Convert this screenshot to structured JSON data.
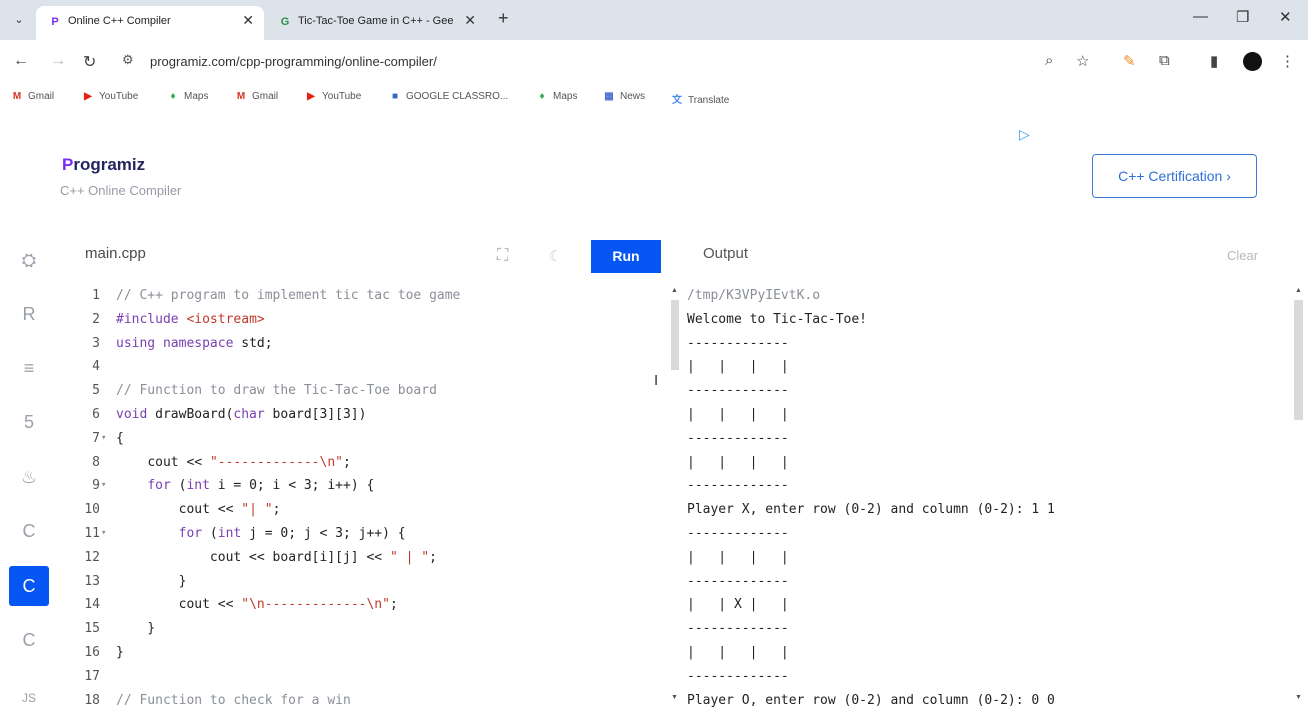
{
  "browser": {
    "tabs": [
      {
        "title": "Online C++ Compiler",
        "favicon": "programiz-p-icon",
        "active": true
      },
      {
        "title": "Tic-Tac-Toe Game in C++ - Gee",
        "favicon": "gfg-icon",
        "active": false
      }
    ],
    "new_tab": "+",
    "url": "programiz.com/cpp-programming/online-compiler/",
    "bookmarks": [
      {
        "label": "Gmail",
        "icon": "gmail-icon",
        "glyph": "M",
        "color": "#d93025"
      },
      {
        "label": "YouTube",
        "icon": "youtube-icon",
        "glyph": "▶",
        "color": "#e62117"
      },
      {
        "label": "Maps",
        "icon": "maps-icon",
        "glyph": "♦",
        "color": "#34a853"
      },
      {
        "label": "Gmail",
        "icon": "gmail-icon",
        "glyph": "M",
        "color": "#d93025"
      },
      {
        "label": "YouTube",
        "icon": "youtube-icon",
        "glyph": "▶",
        "color": "#e62117"
      },
      {
        "label": "GOOGLE CLASSRO...",
        "icon": "classroom-icon",
        "glyph": "■",
        "color": "#3a66c4"
      },
      {
        "label": "Maps",
        "icon": "maps-icon",
        "glyph": "♦",
        "color": "#34a853"
      },
      {
        "label": "News",
        "icon": "news-icon",
        "glyph": "▦",
        "color": "#4a6fd0"
      },
      {
        "label": "Translate",
        "icon": "translate-icon",
        "glyph": "文",
        "color": "#4a8af4"
      }
    ]
  },
  "page": {
    "logo_text": "rogramiz",
    "logo_initial": "P",
    "subtitle": "C++ Online Compiler",
    "cert_button": "C++ Certification ›",
    "file_name": "main.cpp",
    "run_button": "Run",
    "output_label": "Output",
    "clear_button": "Clear",
    "accent_color": "#0556f3"
  },
  "sidebar": {
    "items": [
      {
        "name": "python",
        "glyph": "⛭",
        "active": false
      },
      {
        "name": "r",
        "glyph": "R",
        "active": false
      },
      {
        "name": "sql",
        "glyph": "≡",
        "active": false
      },
      {
        "name": "html",
        "glyph": "5",
        "active": false
      },
      {
        "name": "java",
        "glyph": "♨",
        "active": false
      },
      {
        "name": "c",
        "glyph": "C",
        "active": false
      },
      {
        "name": "cpp",
        "glyph": "C",
        "active": true
      },
      {
        "name": "csharp",
        "glyph": "C",
        "active": false
      },
      {
        "name": "js",
        "glyph": "JS",
        "active": false
      }
    ]
  },
  "editor": {
    "lines": [
      {
        "n": "1",
        "fold": "",
        "code": "// C++ program to implement tic tac toe game"
      },
      {
        "n": "2",
        "fold": "",
        "code": "#include <iostream>"
      },
      {
        "n": "3",
        "fold": "",
        "code": "using namespace std;"
      },
      {
        "n": "4",
        "fold": "",
        "code": ""
      },
      {
        "n": "5",
        "fold": "",
        "code": "// Function to draw the Tic-Tac-Toe board"
      },
      {
        "n": "6",
        "fold": "",
        "code": "void drawBoard(char board[3][3])"
      },
      {
        "n": "7",
        "fold": "▾",
        "code": "{"
      },
      {
        "n": "8",
        "fold": "",
        "code": "    cout << \"-------------\\n\";"
      },
      {
        "n": "9",
        "fold": "▾",
        "code": "    for (int i = 0; i < 3; i++) {"
      },
      {
        "n": "10",
        "fold": "",
        "code": "        cout << \"| \";"
      },
      {
        "n": "11",
        "fold": "▾",
        "code": "        for (int j = 0; j < 3; j++) {"
      },
      {
        "n": "12",
        "fold": "",
        "code": "            cout << board[i][j] << \" | \";"
      },
      {
        "n": "13",
        "fold": "",
        "code": "        }"
      },
      {
        "n": "14",
        "fold": "",
        "code": "        cout << \"\\n-------------\\n\";"
      },
      {
        "n": "15",
        "fold": "",
        "code": "    }"
      },
      {
        "n": "16",
        "fold": "",
        "code": "}"
      },
      {
        "n": "17",
        "fold": "",
        "code": ""
      },
      {
        "n": "18",
        "fold": "",
        "code": "// Function to check for a win"
      }
    ]
  },
  "output": {
    "lines": [
      "/tmp/K3VPyIEvtK.o",
      "Welcome to Tic-Tac-Toe!",
      "-------------",
      "|   |   |   |",
      "-------------",
      "|   |   |   |",
      "-------------",
      "|   |   |   |",
      "-------------",
      "Player X, enter row (0-2) and column (0-2): 1 1",
      "-------------",
      "|   |   |   |",
      "-------------",
      "|   | X |   |",
      "-------------",
      "|   |   |   |",
      "-------------",
      "Player O, enter row (0-2) and column (0-2): 0 0"
    ]
  }
}
